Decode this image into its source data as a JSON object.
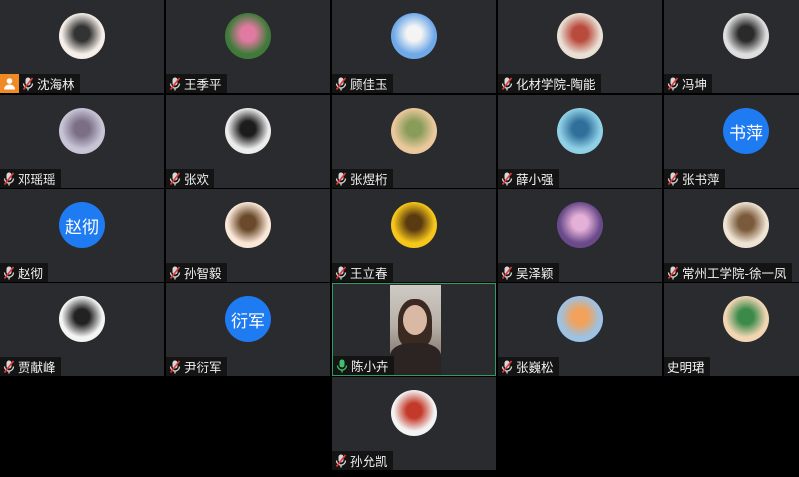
{
  "participants": [
    {
      "name": "沈海林",
      "avatar_colors": [
        "#f6efe9",
        "#333333"
      ],
      "host": true,
      "mic": "muted"
    },
    {
      "name": "王季平",
      "avatar_colors": [
        "#3f7a3a",
        "#e07aa0"
      ],
      "mic": "muted"
    },
    {
      "name": "顾佳玉",
      "avatar_colors": [
        "#6fa9e8",
        "#f4f4f4"
      ],
      "mic": "muted"
    },
    {
      "name": "化材学院-陶能",
      "avatar_colors": [
        "#e9dfd4",
        "#b94b3c"
      ],
      "mic": "muted"
    },
    {
      "name": "冯坤",
      "avatar_colors": [
        "#dedede",
        "#2a2a2a"
      ],
      "mic": "muted"
    },
    {
      "name": "邓瑶瑶",
      "avatar_colors": [
        "#c8c4d6",
        "#7b6f86"
      ],
      "mic": "muted"
    },
    {
      "name": "张欢",
      "avatar_colors": [
        "#ececec",
        "#1c1c1c"
      ],
      "mic": "muted"
    },
    {
      "name": "张煜桁",
      "avatar_colors": [
        "#e9c89c",
        "#8a9c5a"
      ],
      "mic": "muted"
    },
    {
      "name": "薛小强",
      "avatar_colors": [
        "#8fd0e6",
        "#2f6f9a"
      ],
      "mic": "muted"
    },
    {
      "name": "张书萍",
      "avatar_text": "书萍",
      "mic": "muted"
    },
    {
      "name": "赵彻",
      "avatar_text": "赵彻",
      "mic": "muted"
    },
    {
      "name": "孙智毅",
      "avatar_colors": [
        "#fbe7d8",
        "#6a4a2a"
      ],
      "mic": "muted"
    },
    {
      "name": "王立春",
      "avatar_colors": [
        "#f6c61a",
        "#5a3a10"
      ],
      "mic": "muted"
    },
    {
      "name": "吴泽颖",
      "avatar_colors": [
        "#6a4a8a",
        "#e4b0d8"
      ],
      "mic": "muted"
    },
    {
      "name": "常州工学院-徐一凤",
      "avatar_colors": [
        "#efe4d4",
        "#7a5a3a"
      ],
      "mic": "muted"
    },
    {
      "name": "贾献峰",
      "avatar_colors": [
        "#f4f4f4",
        "#222222"
      ],
      "mic": "muted"
    },
    {
      "name": "尹衍军",
      "avatar_text": "衍军",
      "mic": "muted"
    },
    {
      "name": "陈小卉",
      "video": true,
      "mic": "active"
    },
    {
      "name": "张巍松",
      "avatar_colors": [
        "#9cc2e4",
        "#f2a25a"
      ],
      "mic": "muted"
    },
    {
      "name": "史明珺",
      "avatar_colors": [
        "#f2d6b4",
        "#3c8a4a"
      ],
      "mic": "none"
    },
    {
      "name": "孙允凯",
      "avatar_colors": [
        "#f3f3f3",
        "#c43a2a"
      ],
      "mic": "muted"
    }
  ],
  "colors": {
    "tile_bg": "#2a2b2e",
    "avatar_text_bg": "#1f7bf2",
    "host_badge": "#f08a24",
    "muted_mic": "#d8d8d8",
    "muted_slash": "#e23b3b",
    "active_mic": "#3fc26b",
    "active_border": "#2f9c61"
  },
  "icons": {
    "host": "person-icon",
    "muted": "mic-muted-icon",
    "active": "mic-icon"
  }
}
